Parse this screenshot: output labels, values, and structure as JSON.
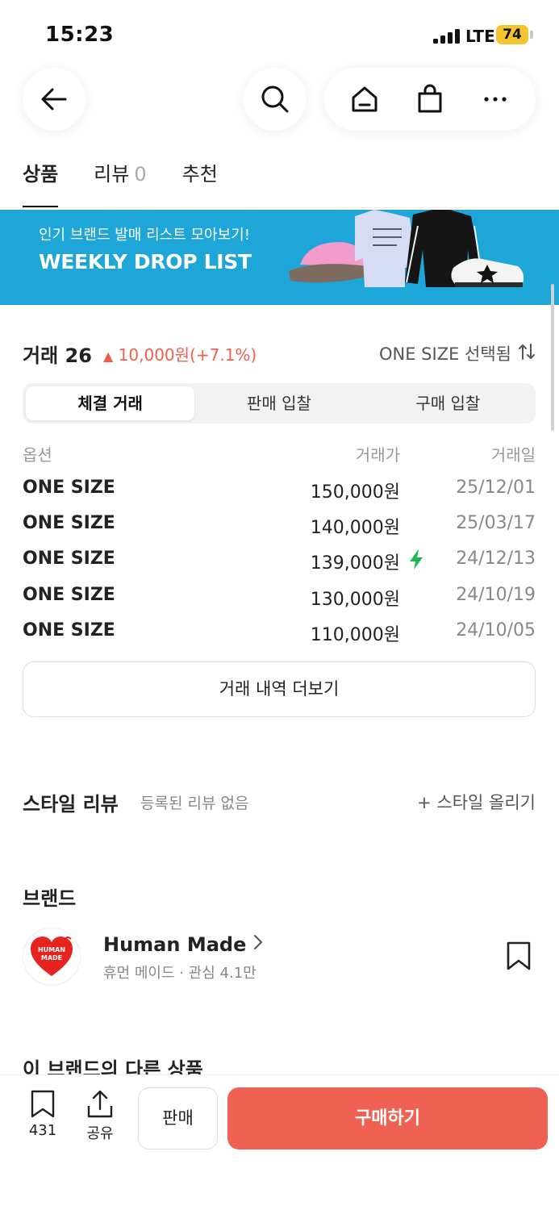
{
  "status_bar": {
    "time": "15:23",
    "network": "LTE",
    "battery": "74"
  },
  "tabs": [
    {
      "label": "상품",
      "count": ""
    },
    {
      "label": "리뷰",
      "count": "0"
    },
    {
      "label": "추천",
      "count": ""
    }
  ],
  "banner": {
    "subtitle": "인기 브랜드 발매 리스트 모아보기!",
    "title": "WEEKLY DROP LIST"
  },
  "trades": {
    "title": "거래 26",
    "change": "10,000원(+7.1%)",
    "size_selected": "ONE SIZE 선택됨",
    "segments": [
      "체결 거래",
      "판매 입찰",
      "구매 입찰"
    ],
    "columns": {
      "option": "옵션",
      "price": "거래가",
      "date": "거래일"
    },
    "rows": [
      {
        "option": "ONE SIZE",
        "price": "150,000원",
        "date": "25/12/01"
      },
      {
        "option": "ONE SIZE",
        "price": "140,000원",
        "date": "25/03/17"
      },
      {
        "option": "ONE SIZE",
        "price": "139,000원",
        "date": "24/12/13"
      },
      {
        "option": "ONE SIZE",
        "price": "130,000원",
        "date": "24/10/19"
      },
      {
        "option": "ONE SIZE",
        "price": "110,000원",
        "date": "24/10/05"
      }
    ],
    "more_label": "거래 내역 더보기"
  },
  "style_review": {
    "title": "스타일 리뷰",
    "empty": "등록된 리뷰 없음",
    "upload": "+ 스타일 올리기"
  },
  "brand": {
    "section_title": "브랜드",
    "name": "Human Made",
    "meta": "휴먼 메이드 · 관심 4.1만",
    "logo_text": "HUMAN MADE"
  },
  "other_products_title": "이 브랜드의 다른 상품",
  "bottom_bar": {
    "wish_count": "431",
    "share_label": "공유",
    "sell_label": "판매",
    "buy_label": "구매하기"
  },
  "colors": {
    "accent_red": "#ef6253",
    "banner_blue": "#1ea6d8",
    "up_red": "#ef5f4e",
    "bolt_green": "#1db954"
  }
}
